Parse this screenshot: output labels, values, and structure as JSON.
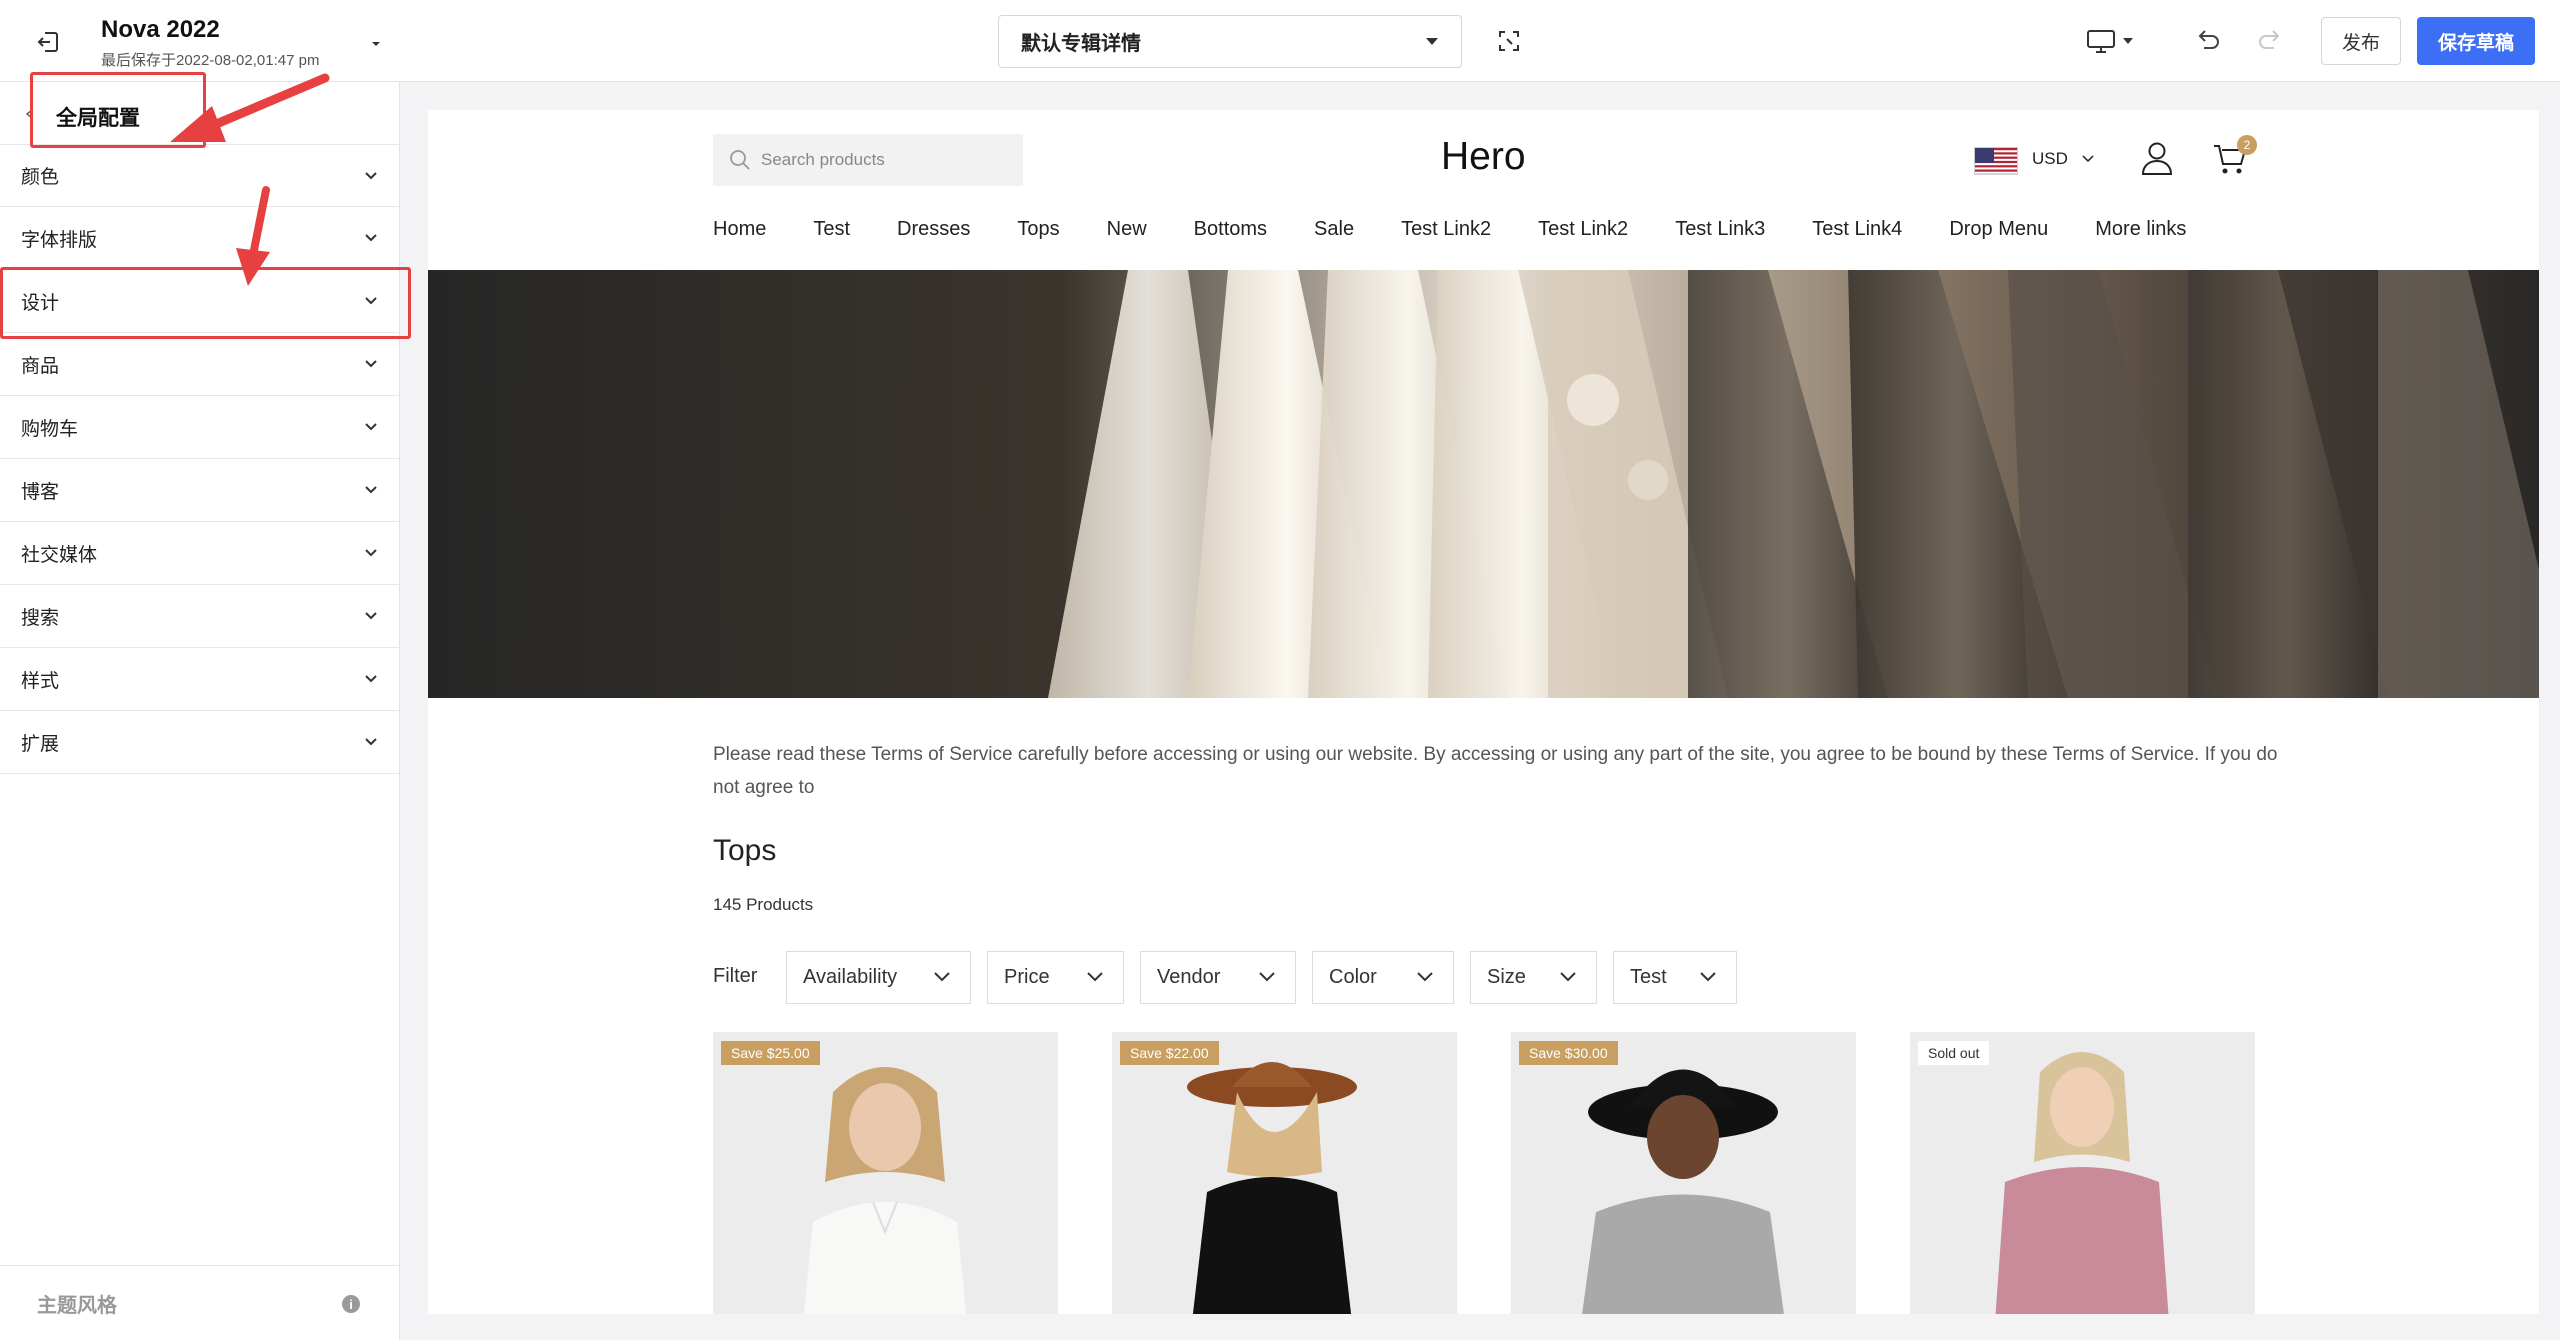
{
  "header": {
    "store_name": "Nova 2022",
    "saved_at": "最后保存于2022-08-02,01:47 pm",
    "template_select": "默认专辑详情",
    "publish_label": "发布",
    "save_draft_label": "保存草稿"
  },
  "sidebar": {
    "title": "全局配置",
    "items": [
      {
        "label": "颜色"
      },
      {
        "label": "字体排版"
      },
      {
        "label": "设计"
      },
      {
        "label": "商品"
      },
      {
        "label": "购物车"
      },
      {
        "label": "博客"
      },
      {
        "label": "社交媒体"
      },
      {
        "label": "搜索"
      },
      {
        "label": "样式"
      },
      {
        "label": "扩展"
      }
    ],
    "footer_label": "主题风格",
    "footer_info_icon": "i"
  },
  "annotations": {
    "highlight_color": "#e64040"
  },
  "preview": {
    "search_placeholder": "Search products",
    "site_title": "Hero",
    "currency": "USD",
    "cart_count": "2",
    "nav": [
      "Home",
      "Test",
      "Dresses",
      "Tops",
      "New",
      "Bottoms",
      "Sale",
      "Test Link2",
      "Test Link2",
      "Test Link3",
      "Test Link4",
      "Drop Menu",
      "More links"
    ],
    "terms_text": "Please read these Terms of Service carefully before accessing or using our website. By accessing or using any part of the site, you agree to be bound by these Terms of Service. If you do not agree to",
    "collection_title": "Tops",
    "product_count": "145 Products",
    "filter_label": "Filter",
    "filters": [
      "Availability",
      "Price",
      "Vendor",
      "Color",
      "Size",
      "Test"
    ],
    "products": [
      {
        "badge": "Save $25.00"
      },
      {
        "badge": "Save $22.00"
      },
      {
        "badge": "Save $30.00"
      },
      {
        "badge": "Sold out"
      }
    ],
    "accent_color": "#c89f61"
  },
  "colors": {
    "primary_button": "#3c6ff5"
  }
}
